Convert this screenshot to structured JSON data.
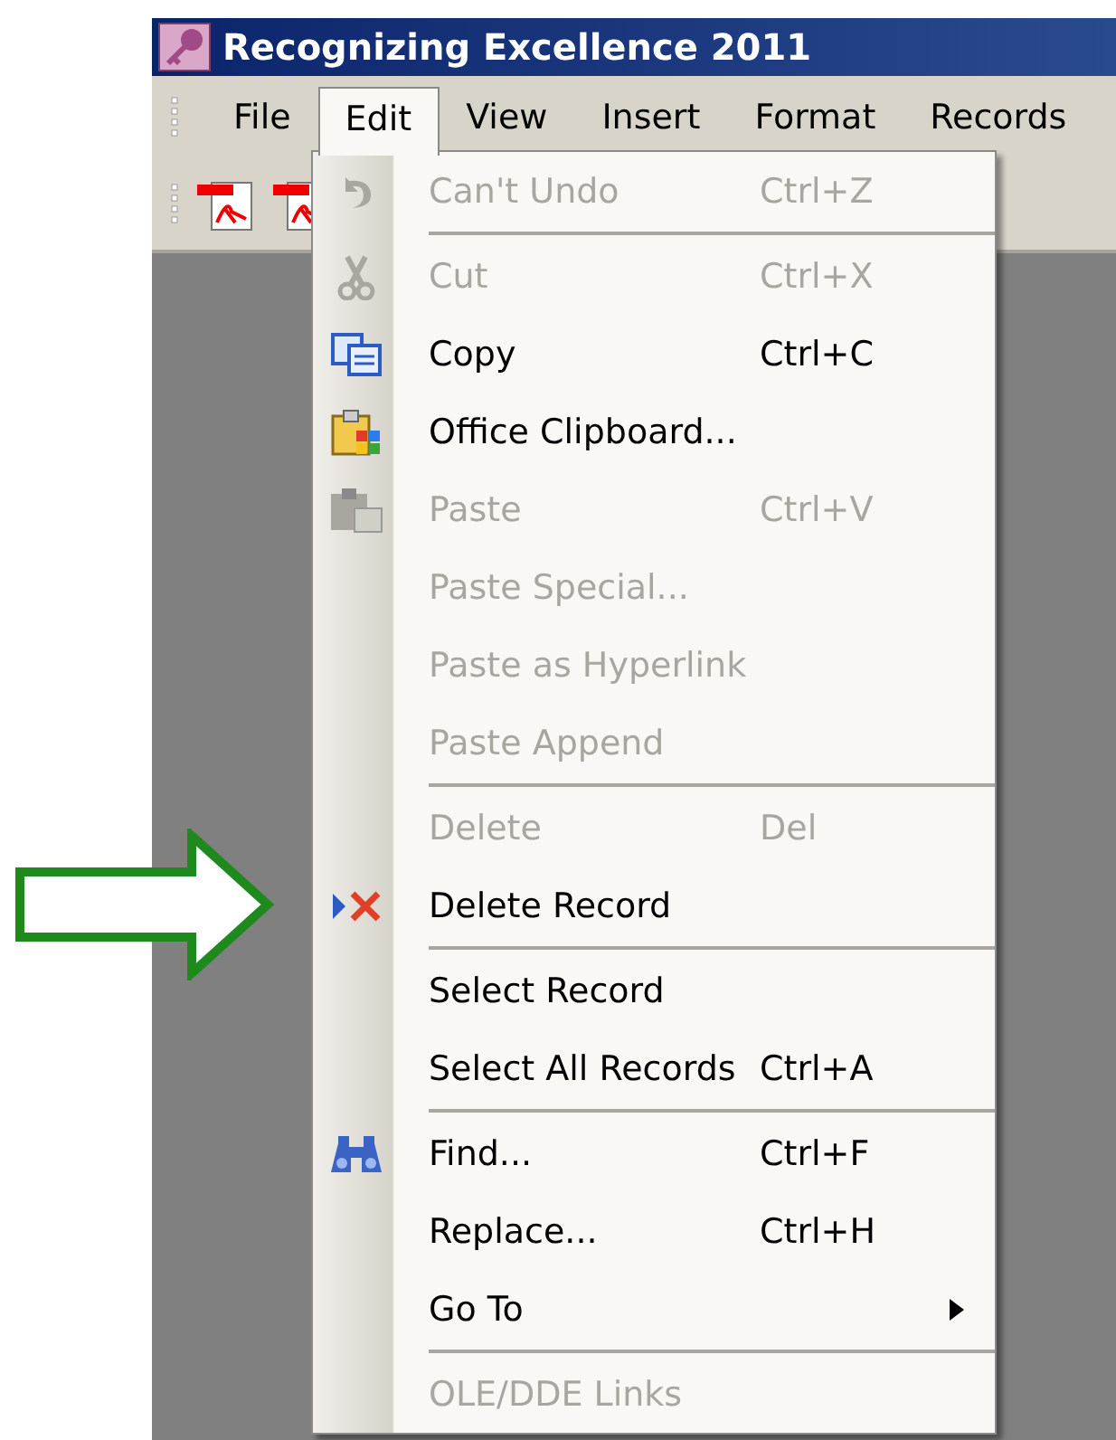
{
  "window": {
    "title": "Recognizing Excellence 2011"
  },
  "menu_bar": [
    {
      "label": "File",
      "selected": false
    },
    {
      "label": "Edit",
      "selected": true
    },
    {
      "label": "View",
      "selected": false
    },
    {
      "label": "Insert",
      "selected": false
    },
    {
      "label": "Format",
      "selected": false
    },
    {
      "label": "Records",
      "selected": false
    }
  ],
  "edit_menu": {
    "items": [
      {
        "kind": "item",
        "label": "Can't Undo",
        "shortcut": "Ctrl+Z",
        "disabled": true,
        "submenu": false
      },
      {
        "kind": "separator"
      },
      {
        "kind": "item",
        "label": "Cut",
        "shortcut": "Ctrl+X",
        "disabled": true,
        "submenu": false
      },
      {
        "kind": "item",
        "label": "Copy",
        "shortcut": "Ctrl+C",
        "disabled": false,
        "submenu": false
      },
      {
        "kind": "item",
        "label": "Office Clipboard...",
        "disabled": false,
        "submenu": false
      },
      {
        "kind": "item",
        "label": "Paste",
        "shortcut": "Ctrl+V",
        "disabled": true,
        "submenu": false
      },
      {
        "kind": "item",
        "label": "Paste Special...",
        "disabled": true,
        "submenu": false
      },
      {
        "kind": "item",
        "label": "Paste as Hyperlink",
        "disabled": true,
        "submenu": false
      },
      {
        "kind": "item",
        "label": "Paste Append",
        "disabled": true,
        "submenu": false
      },
      {
        "kind": "separator"
      },
      {
        "kind": "item",
        "label": "Delete",
        "shortcut": "Del",
        "disabled": true,
        "submenu": false
      },
      {
        "kind": "item",
        "label": "Delete Record",
        "disabled": false,
        "submenu": false
      },
      {
        "kind": "separator"
      },
      {
        "kind": "item",
        "label": "Select Record",
        "disabled": false,
        "submenu": false
      },
      {
        "kind": "item",
        "label": "Select All Records",
        "shortcut": "Ctrl+A",
        "disabled": false,
        "submenu": false
      },
      {
        "kind": "separator"
      },
      {
        "kind": "item",
        "label": "Find...",
        "shortcut": "Ctrl+F",
        "disabled": false,
        "submenu": false
      },
      {
        "kind": "item",
        "label": "Replace...",
        "shortcut": "Ctrl+H",
        "disabled": false,
        "submenu": false
      },
      {
        "kind": "item",
        "label": "Go To",
        "disabled": false,
        "submenu": true
      },
      {
        "kind": "separator"
      },
      {
        "kind": "item",
        "label": "OLE/DDE Links",
        "disabled": true,
        "submenu": false
      }
    ]
  }
}
